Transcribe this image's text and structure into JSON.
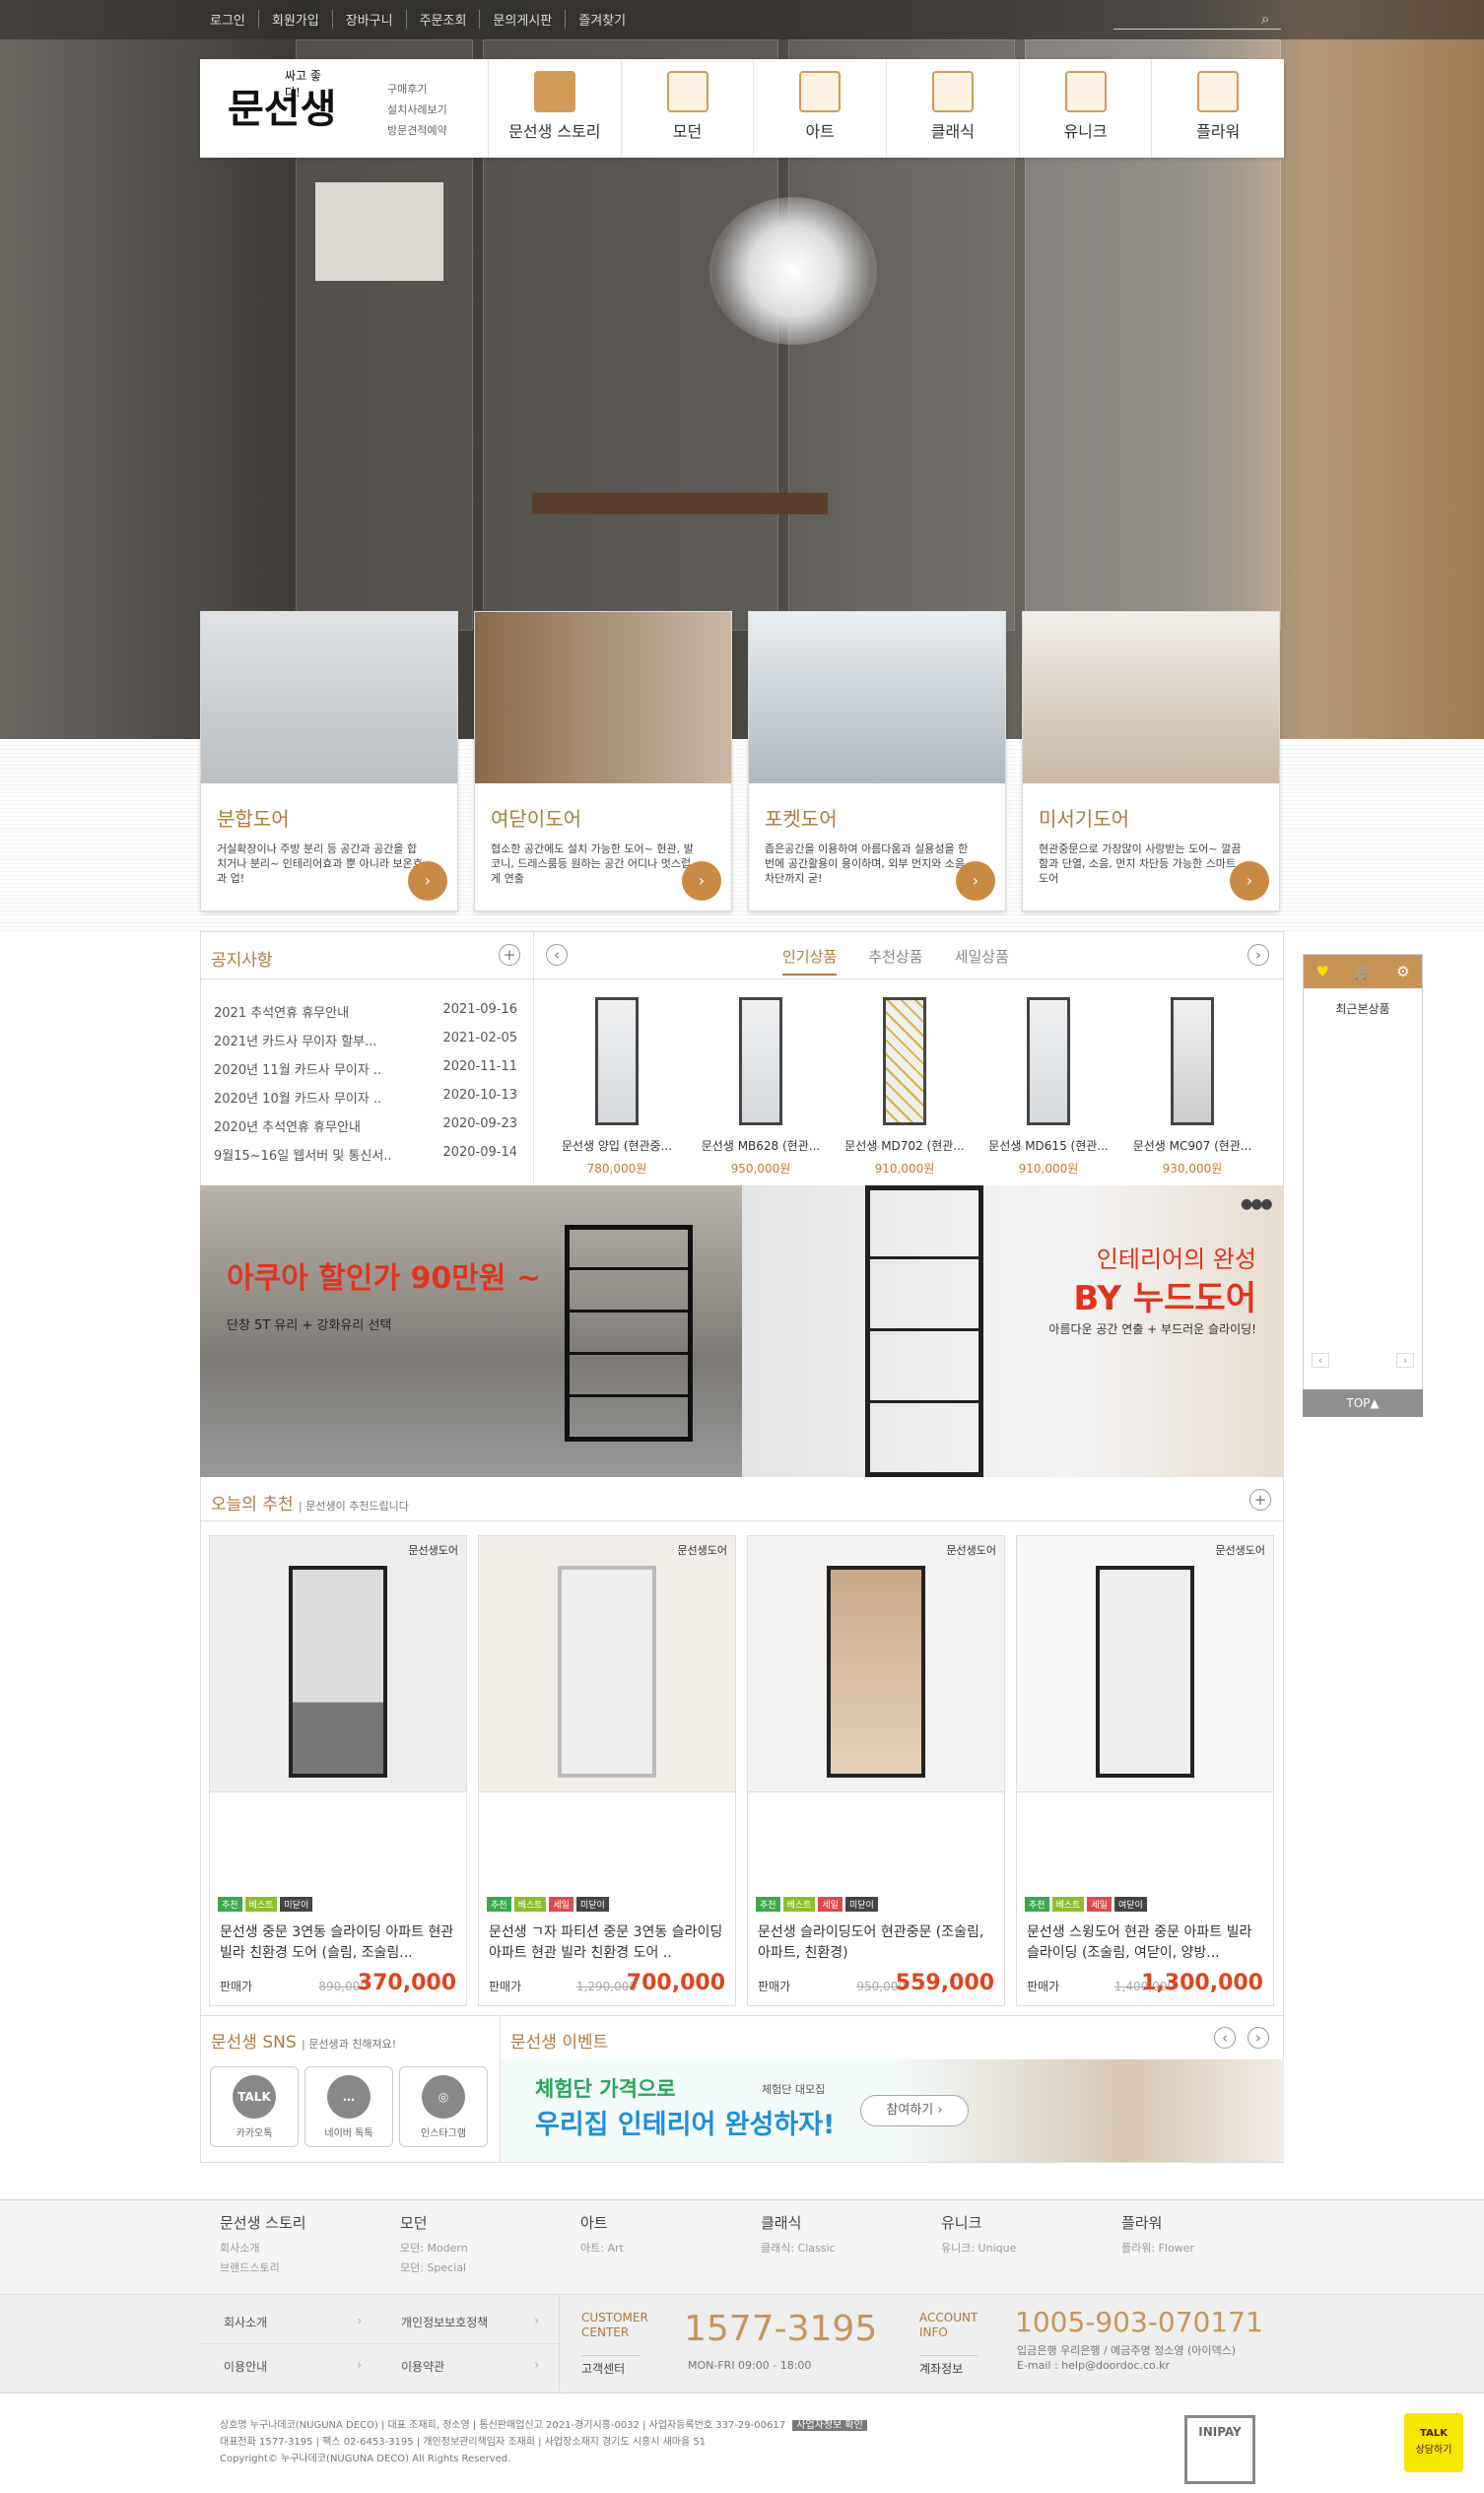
{
  "top": {
    "links": [
      "로그인",
      "회원가입",
      "장바구니",
      "주문조회",
      "문의게시판",
      "즐겨찾기"
    ]
  },
  "nav": {
    "logo": "문선생",
    "tagline": "싸고 좋다!",
    "sublinks": [
      "구매후기",
      "설치사례보기",
      "방문견적예약"
    ],
    "menu": [
      "문선생 스토리",
      "모던",
      "아트",
      "클래식",
      "유니크",
      "플라워"
    ]
  },
  "cards": [
    {
      "title": "분합도어",
      "desc": "거실확장이나 주방 분리 등 공간과 공간을 합치거나 분리~ 인테리어효과 뿐 아니라 보온효과 업!"
    },
    {
      "title": "여닫이도어",
      "desc": "협소한 공간에도 설치 가능한 도어~ 현관, 발코니, 드레스룸등 원하는 공간 어디나 멋스럽게 연출"
    },
    {
      "title": "포켓도어",
      "desc": "좁은공간을 이용하여 아름다움과 실용성을 한번에 공간활용이 용이하며, 외부 먼지와 소음차단까지 굳!"
    },
    {
      "title": "미서기도어",
      "desc": "현관중문으로 가장많이 사랑받는 도어~ 깔끔함과 단열, 소음, 먼지 차단등 가능한 스마트 도어"
    }
  ],
  "notice": {
    "title": "공지사항",
    "items": [
      {
        "t": "2021 추석연휴 휴무안내",
        "d": "2021-09-16"
      },
      {
        "t": "2021년 카드사 무이자 할부...",
        "d": "2021-02-05"
      },
      {
        "t": "2020년 11월 카드사 무이자 ..",
        "d": "2020-11-11"
      },
      {
        "t": "2020년 10월 카드사 무이자 ..",
        "d": "2020-10-13"
      },
      {
        "t": "2020년 추석연휴 휴무안내",
        "d": "2020-09-23"
      },
      {
        "t": "9월15~16일 웹서버 및 통신서..",
        "d": "2020-09-14"
      }
    ]
  },
  "tabs": [
    "인기상품",
    "추천상품",
    "세일상품"
  ],
  "products": [
    {
      "n": "문선생 양입 (현관중...",
      "p": "780,000원"
    },
    {
      "n": "문선생 MB628 (현관...",
      "p": "950,000원"
    },
    {
      "n": "문선생 MD702 (현관...",
      "p": "910,000원"
    },
    {
      "n": "문선생 MD615 (현관...",
      "p": "910,000원"
    },
    {
      "n": "문선생 MC907 (현관...",
      "p": "930,000원"
    }
  ],
  "banner": {
    "left_title": "아쿠아 할인가 90만원 ~",
    "left_sub": "단창 5T 유리 + 강화유리 선택",
    "right_title1": "인테리어의 완성",
    "right_title2": "BY 누드도어",
    "right_sub": "아름다운 공간 연출 + 부드러운 슬라이딩!"
  },
  "recommend": {
    "title": "오늘의 추천",
    "sub": "문선생이 추천드립니다",
    "tag": "문선생도어",
    "items": [
      {
        "name": "문선생 중문 3연동 슬라이딩 아파트 현관 빌라 친환경 도어 (슬림, 조술림...",
        "price_label": "판매가",
        "old": "890,000",
        "new": "370,000",
        "badges": [
          "추천",
          "베스트",
          "미닫이"
        ]
      },
      {
        "name": "문선생 ㄱ자 파티션 중문 3연동 슬라이딩 아파트 현관 빌라 친환경 도어 ..",
        "price_label": "판매가",
        "old": "1,290,000",
        "new": "700,000",
        "badges": [
          "추천",
          "베스트",
          "세일",
          "미닫이"
        ]
      },
      {
        "name": "문선생 슬라이딩도어 현관중문 (조술림, 아파트, 친환경)",
        "price_label": "판매가",
        "old": "950,000",
        "new": "559,000",
        "badges": [
          "추천",
          "베스트",
          "세일",
          "미닫이"
        ]
      },
      {
        "name": "문선생 스윙도어 현관 중문 아파트 빌라 슬라이딩 (조술림, 여닫이, 양방...",
        "price_label": "판매가",
        "old": "1,400,000",
        "new": "1,300,000",
        "badges": [
          "추천",
          "베스트",
          "세일",
          "여닫이"
        ]
      }
    ]
  },
  "sns": {
    "title": "문선생 SNS",
    "sub": "문선생과 친해져요!",
    "items": [
      {
        "ic": "TALK",
        "l": "카카오톡"
      },
      {
        "ic": "…",
        "l": "네이버 톡톡"
      },
      {
        "ic": "◎",
        "l": "인스타그램"
      }
    ]
  },
  "event": {
    "title": "문선생 이벤트",
    "line1": "체험단 가격으로",
    "line2": "우리집 인테리어 완성하자!",
    "badge": "체험단 대모집",
    "btn": "참여하기"
  },
  "side": {
    "title": "최근본상품",
    "top": "TOP▲"
  },
  "footer": {
    "cols": [
      {
        "h": "문선생 스토리",
        "s": [
          "회사소개",
          "브랜드스토리"
        ]
      },
      {
        "h": "모던",
        "s": [
          "모던: Modern",
          "모던: Special"
        ]
      },
      {
        "h": "아트",
        "s": [
          "아트: Art"
        ]
      },
      {
        "h": "클래식",
        "s": [
          "클래식: Classic"
        ]
      },
      {
        "h": "유니크",
        "s": [
          "유니크: Unique"
        ]
      },
      {
        "h": "플라워",
        "s": [
          "플라워: Flower"
        ]
      }
    ],
    "links": [
      "회사소개",
      "개인정보보호정책",
      "이용안내",
      "이용약관"
    ],
    "cc_label1": "CUSTOMER",
    "cc_label2": "CENTER",
    "cc_link": "고객센터",
    "phone": "1577-3195",
    "hours": "MON-FRI 09:00 - 18:00",
    "acc_label1": "ACCOUNT",
    "acc_label2": "INFO",
    "acc_link": "계좌정보",
    "account": "1005-903-070171",
    "bank": "입금은행 우리은행 / 예금주명 정소영 (아이덱스)",
    "email": "E-mail : help@doordoc.co.kr",
    "info1": "상호명 누구나데코(NUGUNA DECO) | 대표 조재희, 정소영 | 통신판매업신고 2021-경기시흥-0032 | 사업자등록번호 337-29-00617",
    "biz_btn": "사업자정보 확인",
    "info2": "대표전화 1577-3195 | 팩스 02-6453-3195 | 개인정보관리책임자 조재희 | 사업장소재지 경기도 시흥시 새마을 51",
    "copy": "Copyright© 누구나데코(NUGUNA DECO) All Rights Reserved.",
    "inipay": "INIPAY",
    "kakao1": "TALK",
    "kakao2": "상담하기"
  }
}
